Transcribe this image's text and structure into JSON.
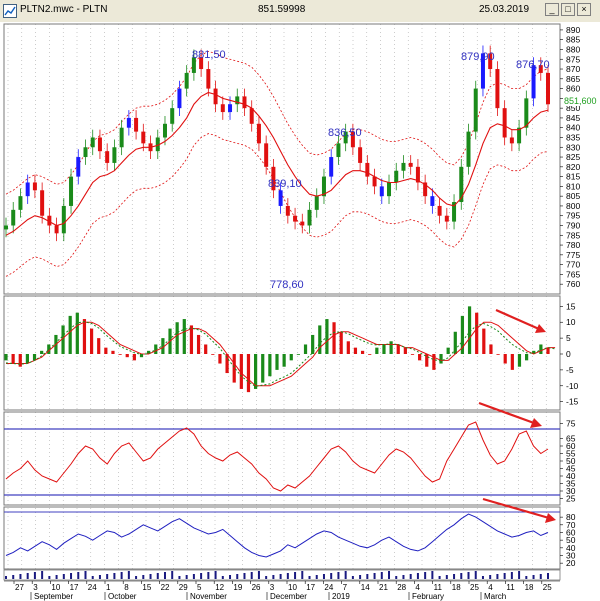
{
  "window": {
    "title": "PLTN2.mwc - PLTN",
    "value": "851.59998",
    "date": "25.03.2019",
    "buttons": {
      "minimize": "_",
      "maximize": "□",
      "close": "×"
    }
  },
  "colors": {
    "grid": "#9a9a9a",
    "up_candle": "#1a8a1a",
    "down_candle": "#e01010",
    "blue_candle": "#1a1aff",
    "ma_line": "#e01010",
    "band_line": "#e01010",
    "oscillator_line": "#e01010",
    "blue_line": "#2020c0",
    "hline": "#4040c0",
    "arrow": "#e02020",
    "annotation": "#3030c0",
    "price_tag": "#20a020"
  },
  "annotations": [
    {
      "text": "881,50"
    },
    {
      "text": "836,50"
    },
    {
      "text": "839,10"
    },
    {
      "text": "778,60"
    },
    {
      "text": "879,90"
    },
    {
      "text": "876,70"
    }
  ],
  "last_price_label": "851,600",
  "price_axis": [
    "890",
    "885",
    "880",
    "875",
    "870",
    "865",
    "860",
    "855",
    "850",
    "845",
    "840",
    "835",
    "830",
    "825",
    "820",
    "815",
    "810",
    "805",
    "800",
    "795",
    "790",
    "785",
    "780",
    "775",
    "770",
    "765",
    "760"
  ],
  "macd_axis": [
    "15",
    "10",
    "5",
    "0",
    "-5",
    "-10",
    "-15"
  ],
  "rsi_axis": [
    "75",
    "65",
    "60",
    "55",
    "50",
    "45",
    "40",
    "35",
    "30",
    "25"
  ],
  "blue_axis": [
    "80",
    "70",
    "60",
    "50",
    "40",
    "30",
    "20"
  ],
  "date_ticks": [
    "27",
    "3",
    "10",
    "17",
    "24",
    "1",
    "8",
    "15",
    "22",
    "29",
    "5",
    "12",
    "19",
    "26",
    "3",
    "10",
    "17",
    "24",
    "7",
    "14",
    "21",
    "28",
    "4",
    "11",
    "18",
    "25",
    "4",
    "11",
    "18",
    "25"
  ],
  "month_labels": [
    "September",
    "October",
    "November",
    "December",
    "2019",
    "February",
    "March"
  ],
  "chart_data": [
    {
      "type": "line",
      "title": "",
      "description": "Candlestick price panel with moving average and envelope bands",
      "ylim": [
        756,
        892
      ],
      "series": [
        {
          "values": [
            790,
            798,
            805,
            812,
            808,
            795,
            790,
            786,
            800,
            815,
            825,
            830,
            835,
            828,
            822,
            830,
            840,
            845,
            838,
            832,
            828,
            835,
            842,
            850,
            860,
            868,
            876,
            870,
            860,
            852,
            848,
            852,
            856,
            850,
            842,
            832,
            820,
            808,
            800,
            795,
            792,
            790,
            798,
            805,
            815,
            825,
            832,
            838,
            830,
            822,
            815,
            810,
            805,
            812,
            818,
            822,
            820,
            812,
            805,
            800,
            795,
            792,
            802,
            820,
            838,
            860,
            878,
            870,
            850,
            835,
            832,
            840,
            855,
            872,
            868,
            852
          ]
        },
        {
          "values": [
            785,
            787,
            790,
            793,
            795,
            794,
            792,
            790,
            791,
            795,
            800,
            806,
            812,
            815,
            816,
            818,
            822,
            826,
            829,
            830,
            830,
            831,
            833,
            836,
            840,
            845,
            852,
            856,
            858,
            857,
            855,
            854,
            853,
            852,
            850,
            846,
            841,
            835,
            828,
            821,
            815,
            810,
            806,
            805,
            806,
            808,
            812,
            816,
            818,
            818,
            817,
            815,
            813,
            812,
            812,
            813,
            814,
            813,
            811,
            808,
            804,
            801,
            800,
            804,
            811,
            821,
            832,
            840,
            842,
            841,
            839,
            839,
            841,
            845,
            848,
            849
          ]
        },
        {
          "values": [
            806,
            808,
            811,
            814,
            816,
            815,
            813,
            811,
            812,
            816,
            821,
            827,
            833,
            836,
            837,
            839,
            843,
            847,
            850,
            851,
            851,
            852,
            854,
            857,
            861,
            866,
            873,
            877,
            879,
            878,
            876,
            875,
            874,
            873,
            871,
            867,
            862,
            856,
            849,
            842,
            836,
            831,
            827,
            826,
            827,
            829,
            833,
            837,
            839,
            839,
            838,
            836,
            834,
            833,
            833,
            834,
            835,
            834,
            832,
            829,
            825,
            822,
            821,
            825,
            832,
            842,
            853,
            861,
            863,
            862,
            860,
            860,
            862,
            866,
            869,
            870
          ]
        },
        {
          "values": [
            764,
            766,
            769,
            772,
            774,
            773,
            771,
            769,
            770,
            774,
            779,
            785,
            791,
            794,
            795,
            797,
            801,
            805,
            808,
            809,
            809,
            810,
            812,
            815,
            819,
            824,
            831,
            835,
            837,
            836,
            834,
            833,
            832,
            831,
            829,
            825,
            820,
            814,
            807,
            800,
            794,
            789,
            785,
            784,
            785,
            787,
            791,
            795,
            797,
            797,
            796,
            794,
            792,
            791,
            791,
            792,
            793,
            792,
            790,
            787,
            783,
            780,
            779,
            783,
            790,
            800,
            811,
            819,
            821,
            820,
            818,
            818,
            820,
            824,
            827,
            828
          ]
        }
      ]
    },
    {
      "type": "bar",
      "title": "",
      "ylim": [
        -17,
        17
      ],
      "series": [
        {
          "values": [
            -2,
            -3,
            -4,
            -3,
            -2,
            1,
            3,
            6,
            9,
            12,
            13,
            11,
            8,
            5,
            2,
            1,
            0,
            -1,
            -2,
            -1,
            1,
            3,
            5,
            8,
            10,
            11,
            9,
            6,
            3,
            0,
            -3,
            -6,
            -9,
            -11,
            -12,
            -11,
            -9,
            -7,
            -5,
            -4,
            -2,
            0,
            3,
            6,
            9,
            11,
            10,
            7,
            4,
            2,
            1,
            0,
            2,
            3,
            4,
            3,
            2,
            0,
            -2,
            -4,
            -5,
            -3,
            2,
            7,
            12,
            15,
            13,
            8,
            3,
            0,
            -3,
            -5,
            -4,
            -2,
            1,
            3,
            2
          ]
        },
        {
          "values": [
            -3,
            -3,
            -3,
            -3,
            -2,
            -1,
            1,
            3,
            5,
            7,
            9,
            10,
            10,
            9,
            7,
            5,
            3,
            2,
            1,
            0,
            0,
            1,
            2,
            4,
            6,
            7,
            8,
            8,
            7,
            5,
            3,
            0,
            -3,
            -6,
            -8,
            -10,
            -10,
            -10,
            -9,
            -8,
            -7,
            -5,
            -3,
            -1,
            2,
            4,
            6,
            7,
            7,
            6,
            5,
            4,
            3,
            3,
            3,
            3,
            2,
            2,
            1,
            0,
            -1,
            -2,
            -2,
            0,
            2,
            5,
            8,
            10,
            10,
            9,
            7,
            5,
            3,
            1,
            0,
            1,
            2,
            2
          ]
        }
      ]
    },
    {
      "type": "line",
      "title": "",
      "ylim": [
        22,
        80
      ],
      "series": [
        {
          "values": [
            38,
            42,
            45,
            50,
            44,
            40,
            38,
            36,
            42,
            48,
            55,
            60,
            58,
            52,
            48,
            55,
            60,
            62,
            56,
            50,
            52,
            58,
            62,
            66,
            70,
            72,
            68,
            60,
            55,
            52,
            50,
            54,
            56,
            52,
            48,
            42,
            38,
            32,
            30,
            34,
            32,
            36,
            40,
            46,
            52,
            58,
            60,
            56,
            50,
            46,
            44,
            42,
            48,
            54,
            58,
            56,
            52,
            46,
            40,
            36,
            38,
            50,
            58,
            66,
            74,
            76,
            64,
            54,
            48,
            50,
            58,
            68,
            70,
            60,
            55,
            58
          ]
        }
      ]
    },
    {
      "type": "line",
      "title": "",
      "ylim": [
        15,
        88
      ],
      "series": [
        {
          "values": [
            30,
            34,
            40,
            36,
            42,
            48,
            44,
            38,
            46,
            52,
            58,
            55,
            50,
            56,
            62,
            60,
            54,
            58,
            64,
            70,
            66,
            62,
            68,
            74,
            78,
            72,
            66,
            62,
            58,
            60,
            64,
            56,
            48,
            40,
            34,
            30,
            28,
            32,
            36,
            44,
            40,
            46,
            52,
            58,
            62,
            60,
            54,
            50,
            46,
            42,
            40,
            44,
            50,
            54,
            48,
            42,
            38,
            36,
            40,
            48,
            56,
            64,
            70,
            78,
            84,
            80,
            74,
            68,
            62,
            58,
            54,
            56,
            60,
            62,
            56,
            60
          ]
        }
      ]
    }
  ]
}
